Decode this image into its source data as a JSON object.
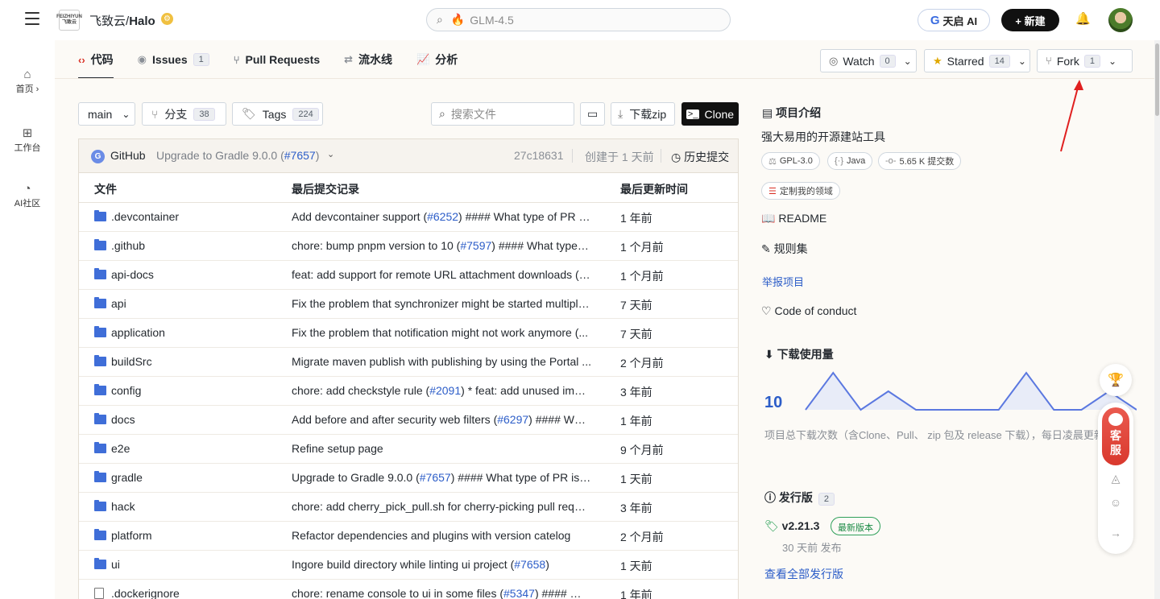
{
  "header": {
    "logo_text": "FEIZHIYUN 飞致云",
    "repo_owner": "飞致云",
    "repo_sep": "/",
    "repo_name": "Halo",
    "search_placeholder": "GLM-4.5",
    "tianqi_label": "天启 AI",
    "new_label": "+ 新建"
  },
  "leftnav": {
    "items": [
      {
        "label": "首页 ›",
        "icon": "home-icon"
      },
      {
        "label": "工作台",
        "icon": "grid-icon"
      },
      {
        "label": "AI社区",
        "icon": "ai-community-icon"
      }
    ]
  },
  "tabs": [
    {
      "label": "代码",
      "icon": "code-icon",
      "active": true
    },
    {
      "label": "Issues",
      "count": "1",
      "icon": "issue-icon"
    },
    {
      "label": "Pull Requests",
      "icon": "pr-icon"
    },
    {
      "label": "流水线",
      "icon": "pipeline-icon"
    },
    {
      "label": "分析",
      "icon": "chart-icon"
    }
  ],
  "repo_actions": {
    "watch": {
      "label": "Watch",
      "count": "0"
    },
    "starred": {
      "label": "Starred",
      "count": "14"
    },
    "fork": {
      "label": "Fork",
      "count": "1"
    }
  },
  "toolbar": {
    "branch": "main",
    "branches_label": "分支",
    "branches_count": "38",
    "tags_label": "Tags",
    "tags_count": "224",
    "search_placeholder": "搜索文件",
    "download_label": "下载zip",
    "clone_label": "Clone"
  },
  "latest_commit": {
    "author": "GitHub",
    "message_prefix": "Upgrade to Gradle 9.0.0 (",
    "message_link": "#7657",
    "message_suffix": ")",
    "sha": "27c18631",
    "created": "创建于 1 天前",
    "history_label": "历史提交"
  },
  "table": {
    "headers": {
      "file": "文件",
      "commit": "最后提交记录",
      "time": "最后更新时间"
    },
    "rows": [
      {
        "name": ".devcontainer",
        "type": "dir",
        "pre": "Add devcontainer support (",
        "link": "#6252",
        "post": ") #### What type of PR is...",
        "time": "1 年前"
      },
      {
        "name": ".github",
        "type": "dir",
        "pre": "chore: bump pnpm version to 10 (",
        "link": "#7597",
        "post": ") #### What type o...",
        "time": "1 个月前"
      },
      {
        "name": "api-docs",
        "type": "dir",
        "pre": "feat: add support for remote URL attachment downloads (",
        "link": "#...",
        "post": "",
        "time": "1 个月前"
      },
      {
        "name": "api",
        "type": "dir",
        "pre": "Fix the problem that synchronizer might be started multiple...",
        "link": "",
        "post": "",
        "time": "7 天前"
      },
      {
        "name": "application",
        "type": "dir",
        "pre": "Fix the problem that notification might not work anymore (...",
        "link": "",
        "post": "",
        "time": "7 天前"
      },
      {
        "name": "buildSrc",
        "type": "dir",
        "pre": "Migrate maven publish with publishing by using the Portal ...",
        "link": "",
        "post": "",
        "time": "2 个月前"
      },
      {
        "name": "config",
        "type": "dir",
        "pre": "chore: add checkstyle rule (",
        "link": "#2091",
        "post": ") * feat: add unused impor...",
        "time": "3 年前"
      },
      {
        "name": "docs",
        "type": "dir",
        "pre": "Add before and after security web filters (",
        "link": "#6297",
        "post": ") #### Wha...",
        "time": "1 年前"
      },
      {
        "name": "e2e",
        "type": "dir",
        "pre": "Refine setup page",
        "link": "",
        "post": "",
        "time": "9 个月前"
      },
      {
        "name": "gradle",
        "type": "dir",
        "pre": "Upgrade to Gradle 9.0.0 (",
        "link": "#7657",
        "post": ") #### What type of PR is th...",
        "time": "1 天前"
      },
      {
        "name": "hack",
        "type": "dir",
        "pre": "chore: add cherry_pick_pull.sh for cherry-picking pull reque...",
        "link": "",
        "post": "",
        "time": "3 年前"
      },
      {
        "name": "platform",
        "type": "dir",
        "pre": "Refactor dependencies and plugins with version catelog",
        "link": "",
        "post": "",
        "time": "2 个月前"
      },
      {
        "name": "ui",
        "type": "dir",
        "pre": "Ingore build directory while linting ui project (",
        "link": "#7658",
        "post": ")",
        "time": "1 天前"
      },
      {
        "name": ".dockerignore",
        "type": "file",
        "pre": "chore: rename console to ui in some files (",
        "link": "#5347",
        "post": ") #### Wh...",
        "time": "1 年前"
      }
    ]
  },
  "about": {
    "title": "项目介绍",
    "description": "强大易用的开源建站工具",
    "license": "GPL-3.0",
    "language": "Java",
    "commits": "5.65 K 提交数",
    "customize": "定制我的领域",
    "readme": "README",
    "rules": "规则集",
    "report": "举报项目",
    "conduct": "Code of conduct"
  },
  "downloads": {
    "title": "下载使用量",
    "value": "10",
    "note": "项目总下载次数（含Clone、Pull、 zip 包及 release 下载），每日凌晨更新"
  },
  "chart_data": {
    "type": "area",
    "values": [
      0,
      10,
      0,
      5,
      0,
      0,
      0,
      0,
      10,
      0,
      0,
      5,
      0
    ],
    "title": "",
    "xlabel": "",
    "ylabel": ""
  },
  "releases": {
    "title": "发行版",
    "count": "2",
    "version": "v2.21.3",
    "badge": "最新版本",
    "published": "30 天前 发布",
    "view_all": "查看全部发行版"
  },
  "floating": {
    "kefu_1": "客",
    "kefu_2": "服"
  },
  "colors": {
    "accent": "#2c5dc8",
    "active_tab_icon": "#d93025",
    "chart_line": "#5b78e0",
    "annotation_arrow": "#e02020"
  }
}
